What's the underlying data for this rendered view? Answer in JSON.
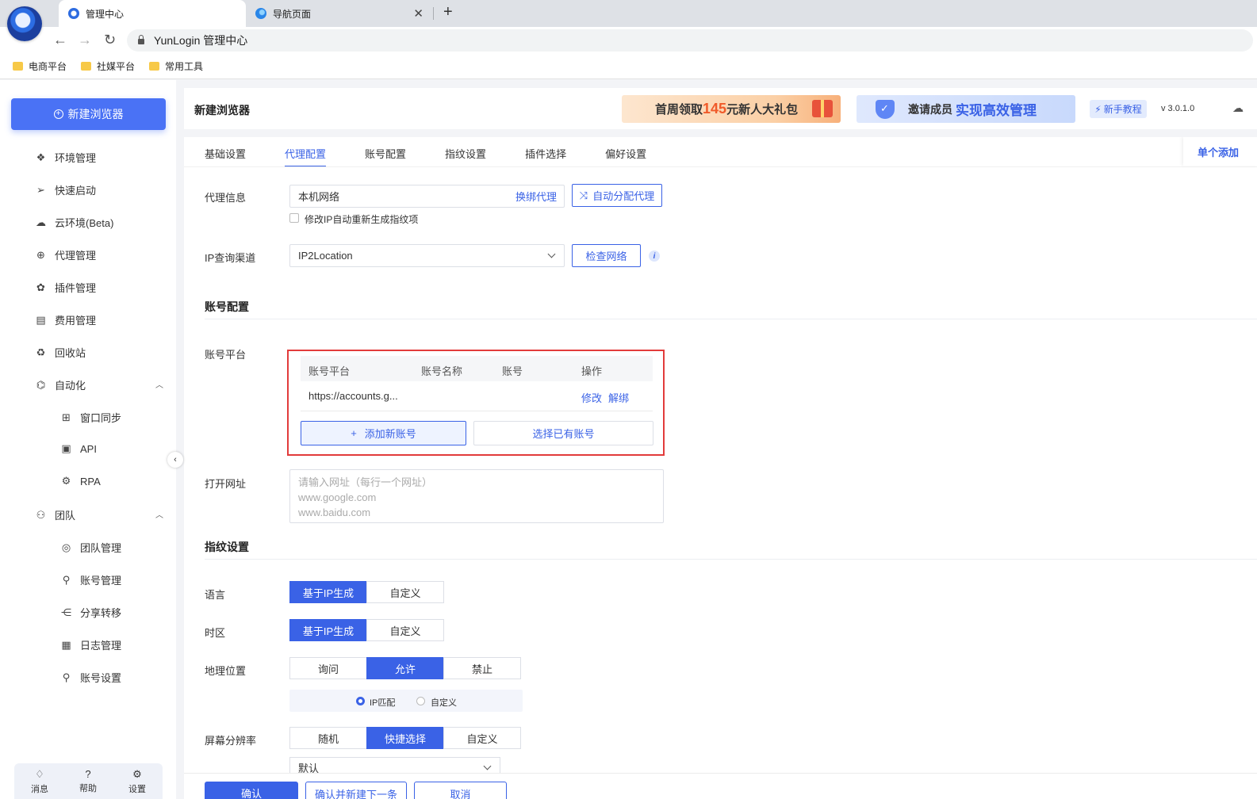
{
  "browser": {
    "tabs": [
      {
        "title": "管理中心",
        "active": true
      },
      {
        "title": "导航页面",
        "active": false
      }
    ],
    "address": "YunLogin 管理中心",
    "bookmarks": [
      "电商平台",
      "社媒平台",
      "常用工具"
    ]
  },
  "sidebar": {
    "new_browser": "新建浏览器",
    "items": [
      {
        "label": "环境管理",
        "icon": "cube-icon"
      },
      {
        "label": "快速启动",
        "icon": "send-icon"
      },
      {
        "label": "云环境(Beta)",
        "icon": "cloud-icon"
      },
      {
        "label": "代理管理",
        "icon": "globe-icon"
      },
      {
        "label": "插件管理",
        "icon": "puzzle-icon"
      },
      {
        "label": "费用管理",
        "icon": "bill-icon"
      },
      {
        "label": "回收站",
        "icon": "recycle-icon"
      },
      {
        "label": "自动化",
        "icon": "automation-icon"
      },
      {
        "label": "窗口同步",
        "icon": "window-sync-icon"
      },
      {
        "label": "API",
        "icon": "api-icon"
      },
      {
        "label": "RPA",
        "icon": "robot-icon"
      },
      {
        "label": "团队",
        "icon": "team-icon"
      },
      {
        "label": "团队管理",
        "icon": "team-manage-icon"
      },
      {
        "label": "账号管理",
        "icon": "user-icon"
      },
      {
        "label": "分享转移",
        "icon": "share-icon"
      },
      {
        "label": "日志管理",
        "icon": "log-icon"
      },
      {
        "label": "账号设置",
        "icon": "user-settings-icon"
      }
    ],
    "bottom": [
      "消息",
      "帮助",
      "设置"
    ]
  },
  "header": {
    "title": "新建浏览器",
    "banner1_pre": "首周领取",
    "banner1_hl": "145",
    "banner1_post": "元新人大礼包",
    "banner2_pre": "邀请成员",
    "banner2_hl": "实现高效管理",
    "tutorial": "新手教程",
    "version": "v 3.0.1.0"
  },
  "form": {
    "tabs": [
      "基础设置",
      "代理配置",
      "账号配置",
      "指纹设置",
      "插件选择",
      "偏好设置"
    ],
    "active_tab": "代理配置",
    "single_add": "单个添加",
    "proxy_label": "代理信息",
    "proxy_value": "本机网络",
    "proxy_change": "换绑代理",
    "auto_assign": "自动分配代理",
    "regen_checkbox": "修改IP自动重新生成指纹项",
    "ip_channel_label": "IP查询渠道",
    "ip_channel_value": "IP2Location",
    "check_network": "检查网络",
    "account_section": "账号配置",
    "account_platform_label": "账号平台",
    "account_table": {
      "columns": [
        "账号平台",
        "账号名称",
        "账号",
        "操作"
      ],
      "rows": [
        {
          "platform": "https://accounts.g...",
          "name": "",
          "account": "",
          "edit": "修改",
          "unbind": "解绑"
        }
      ]
    },
    "add_account": "添加新账号",
    "select_account": "选择已有账号",
    "open_url_label": "打开网址",
    "open_url_placeholder": "请输入网址（每行一个网址）\nwww.google.com\nwww.baidu.com",
    "fingerprint_section": "指纹设置",
    "language_label": "语言",
    "language_options": [
      "基于IP生成",
      "自定义"
    ],
    "timezone_label": "时区",
    "timezone_options": [
      "基于IP生成",
      "自定义"
    ],
    "geo_label": "地理位置",
    "geo_options": [
      "询问",
      "允许",
      "禁止"
    ],
    "geo_radio": [
      "IP匹配",
      "自定义"
    ],
    "resolution_label": "屏幕分辨率",
    "resolution_options": [
      "随机",
      "快捷选择",
      "自定义"
    ],
    "resolution_select": "默认",
    "footer": [
      "确认",
      "确认并新建下一条",
      "取消"
    ]
  },
  "colors": {
    "primary": "#3a62e6",
    "button": "#4a72f5",
    "highlight_border": "#e23b3b"
  }
}
